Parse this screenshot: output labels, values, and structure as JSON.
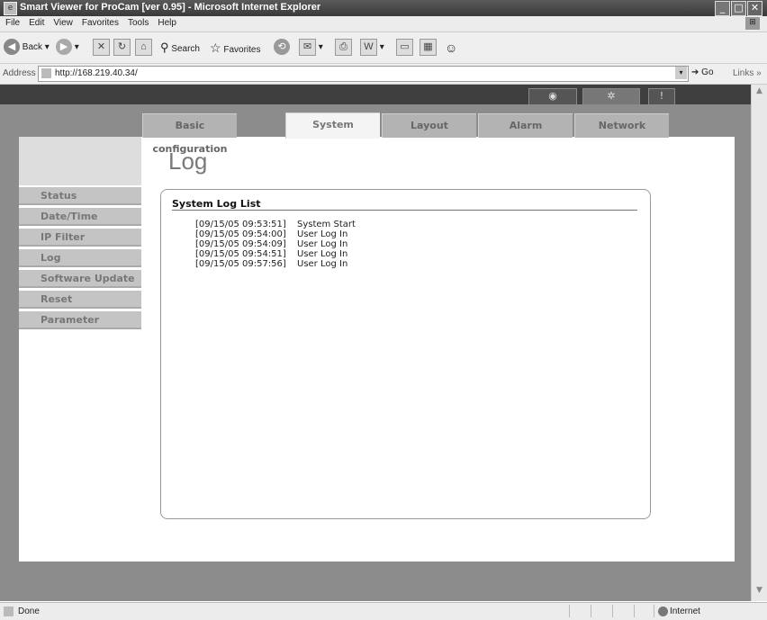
{
  "window": {
    "title": "Smart Viewer for ProCam [ver 0.95] - Microsoft Internet Explorer",
    "controls": [
      "minimize",
      "maximize",
      "close"
    ]
  },
  "menu": [
    "File",
    "Edit",
    "View",
    "Favorites",
    "Tools",
    "Help"
  ],
  "toolbar": {
    "back_label": "Back",
    "search_label": "Search",
    "favorites_label": "Favorites"
  },
  "address": {
    "label": "Address",
    "url": "http://168.219.40.34/",
    "go_label": "Go",
    "links_label": "Links"
  },
  "tabs": [
    {
      "label": "Basic configuration",
      "active": false
    },
    {
      "label": "System",
      "active": true
    },
    {
      "label": "Layout",
      "active": false
    },
    {
      "label": "Alarm",
      "active": false
    },
    {
      "label": "Network",
      "active": false
    }
  ],
  "sidebar": {
    "items": [
      {
        "label": "Status"
      },
      {
        "label": "Date/Time"
      },
      {
        "label": "IP Filter"
      },
      {
        "label": "Log"
      },
      {
        "label": "Software Update"
      },
      {
        "label": "Reset"
      },
      {
        "label": "Parameter"
      }
    ]
  },
  "main": {
    "title": "Log",
    "panel_title": "System Log List",
    "logs": [
      {
        "time": "[09/15/05 09:53:51]",
        "event": "System Start"
      },
      {
        "time": "[09/15/05 09:54:00]",
        "event": "User Log In"
      },
      {
        "time": "[09/15/05 09:54:09]",
        "event": "User Log In"
      },
      {
        "time": "[09/15/05 09:54:51]",
        "event": "User Log In"
      },
      {
        "time": "[09/15/05 09:57:56]",
        "event": "User Log In"
      }
    ]
  },
  "status": {
    "text": "Done",
    "zone": "Internet"
  }
}
